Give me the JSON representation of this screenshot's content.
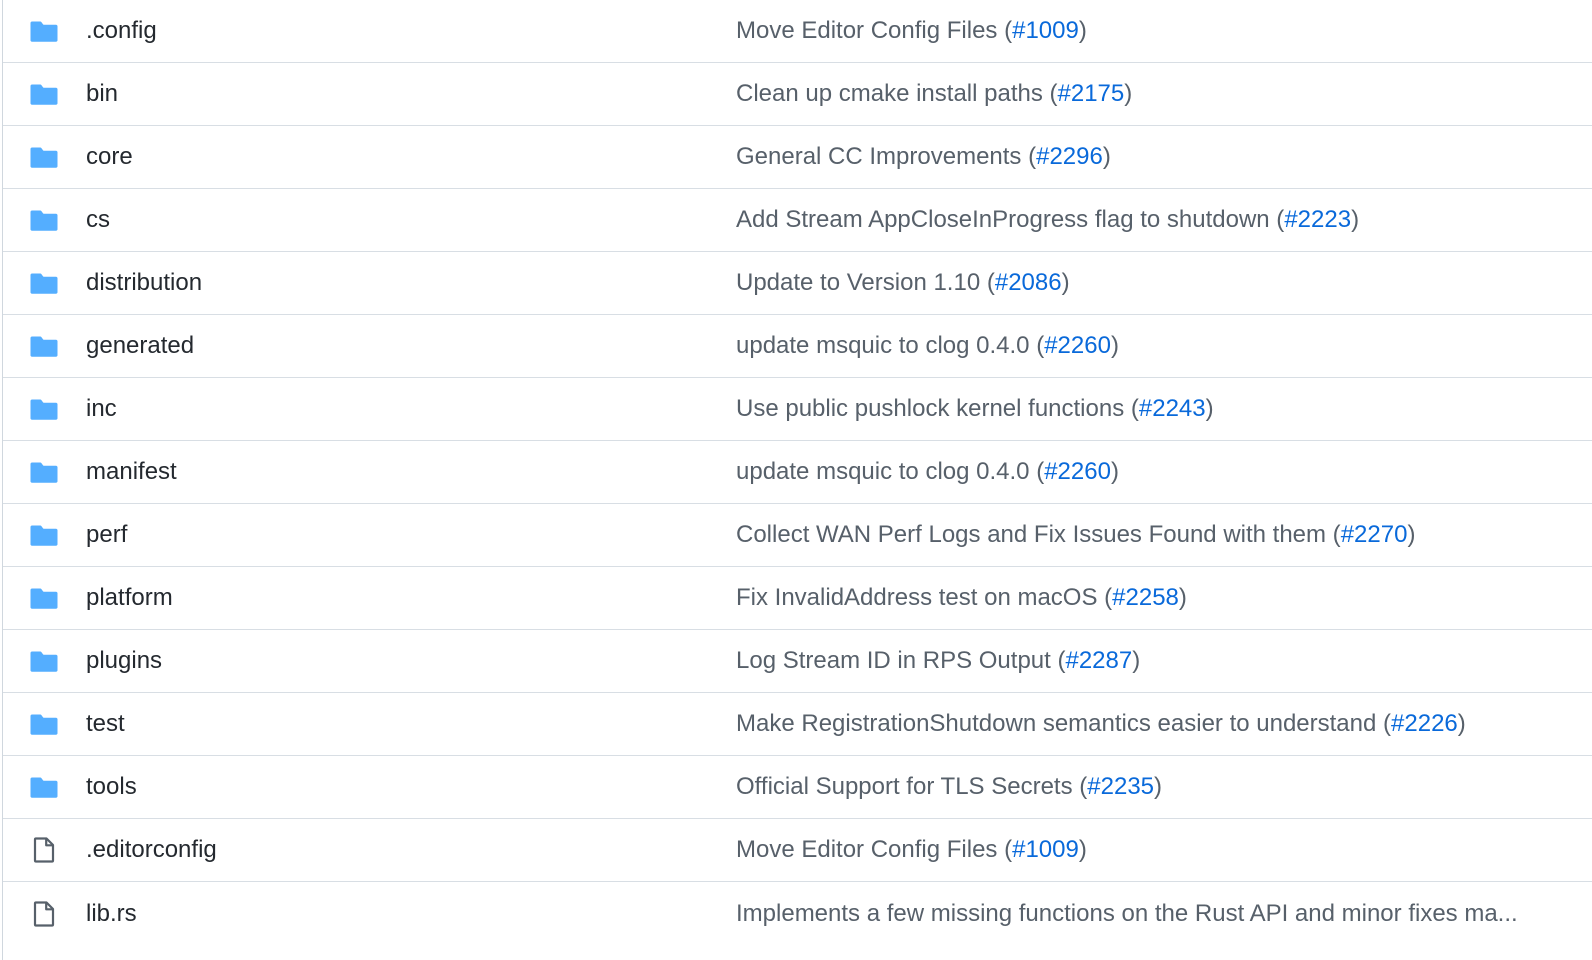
{
  "colors": {
    "folder_icon": "#54aeff",
    "file_icon": "#57606a",
    "link": "#0969da",
    "message_text": "#57606a",
    "name_text": "#24292f",
    "divider": "#d8dee4"
  },
  "files": [
    {
      "type": "folder",
      "icon": "folder-icon",
      "name": ".config",
      "message": "Move Editor Config Files",
      "pr": "#1009"
    },
    {
      "type": "folder",
      "icon": "folder-icon",
      "name": "bin",
      "message": "Clean up cmake install paths",
      "pr": "#2175"
    },
    {
      "type": "folder",
      "icon": "folder-icon",
      "name": "core",
      "message": "General CC Improvements",
      "pr": "#2296"
    },
    {
      "type": "folder",
      "icon": "folder-icon",
      "name": "cs",
      "message": "Add Stream AppCloseInProgress flag to shutdown",
      "pr": "#2223"
    },
    {
      "type": "folder",
      "icon": "folder-icon",
      "name": "distribution",
      "message": "Update to Version 1.10",
      "pr": "#2086"
    },
    {
      "type": "folder",
      "icon": "folder-icon",
      "name": "generated",
      "message": "update msquic to clog 0.4.0",
      "pr": "#2260"
    },
    {
      "type": "folder",
      "icon": "folder-icon",
      "name": "inc",
      "message": "Use public pushlock kernel functions",
      "pr": "#2243"
    },
    {
      "type": "folder",
      "icon": "folder-icon",
      "name": "manifest",
      "message": "update msquic to clog 0.4.0",
      "pr": "#2260"
    },
    {
      "type": "folder",
      "icon": "folder-icon",
      "name": "perf",
      "message": "Collect WAN Perf Logs and Fix Issues Found with them",
      "pr": "#2270"
    },
    {
      "type": "folder",
      "icon": "folder-icon",
      "name": "platform",
      "message": "Fix InvalidAddress test on macOS",
      "pr": "#2258"
    },
    {
      "type": "folder",
      "icon": "folder-icon",
      "name": "plugins",
      "message": "Log Stream ID in RPS Output",
      "pr": "#2287"
    },
    {
      "type": "folder",
      "icon": "folder-icon",
      "name": "test",
      "message": "Make RegistrationShutdown semantics easier to understand",
      "pr": "#2226"
    },
    {
      "type": "folder",
      "icon": "folder-icon",
      "name": "tools",
      "message": "Official Support for TLS Secrets",
      "pr": "#2235"
    },
    {
      "type": "file",
      "icon": "file-icon",
      "name": ".editorconfig",
      "message": "Move Editor Config Files",
      "pr": "#1009"
    },
    {
      "type": "file",
      "icon": "file-icon",
      "name": "lib.rs",
      "message": "Implements a few missing functions on the Rust API and minor fixes ma...",
      "pr": ""
    }
  ]
}
